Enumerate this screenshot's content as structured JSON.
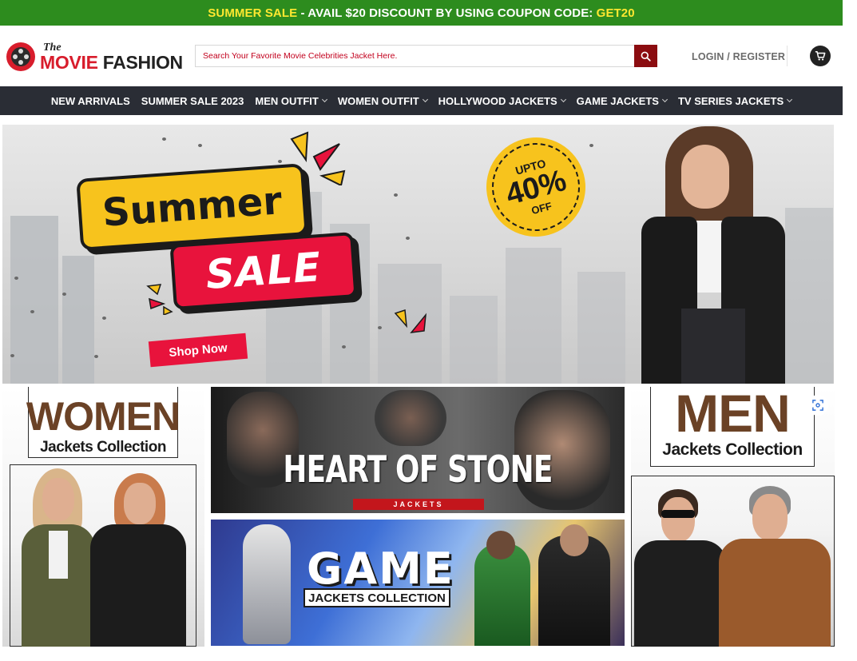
{
  "promo": {
    "label_sale": "SUMMER SALE",
    "label_mid": " - AVAIL $20 DISCOUNT BY USING COUPON CODE: ",
    "code": "GET20"
  },
  "header": {
    "logo_the": "The",
    "logo_movie": "MOVIE",
    "logo_fashion": " FASHION",
    "search_placeholder": "Search Your Favorite Movie Celebrities Jacket Here.",
    "login_label": "LOGIN / REGISTER"
  },
  "nav": {
    "items": [
      {
        "label": "NEW ARRIVALS",
        "has_dropdown": false
      },
      {
        "label": "SUMMER SALE 2023",
        "has_dropdown": false
      },
      {
        "label": "MEN OUTFIT",
        "has_dropdown": true
      },
      {
        "label": "WOMEN OUTFIT",
        "has_dropdown": true
      },
      {
        "label": "HOLLYWOOD JACKETS",
        "has_dropdown": true
      },
      {
        "label": "GAME JACKETS",
        "has_dropdown": true
      },
      {
        "label": "TV SERIES JACKETS",
        "has_dropdown": true
      }
    ]
  },
  "hero": {
    "summer": "Summer",
    "sale": "SALE",
    "shop_now": "Shop Now",
    "badge_top": "UPTO",
    "badge_value": "40%",
    "badge_bottom": "OFF"
  },
  "promos": {
    "women_big": "WOMEN",
    "women_sub": "Jackets Collection",
    "men_big": "MEN",
    "men_sub": "Jackets Collection",
    "hos_title": "HEART OF STONE",
    "hos_sub": "JACKETS",
    "game_title": "GAME",
    "game_sub": "JACKETS COLLECTION"
  },
  "colors": {
    "promo_bg": "#2d8c1e",
    "promo_highlight": "#ffe830",
    "nav_bg": "#2a2d35",
    "search_btn": "#8b0c10",
    "brand_red": "#d81d2c",
    "label_brown": "#6b4226"
  },
  "icons": {
    "search": "search-icon",
    "cart": "cart-icon",
    "lens": "lens-icon",
    "logo": "film-reel-icon"
  }
}
